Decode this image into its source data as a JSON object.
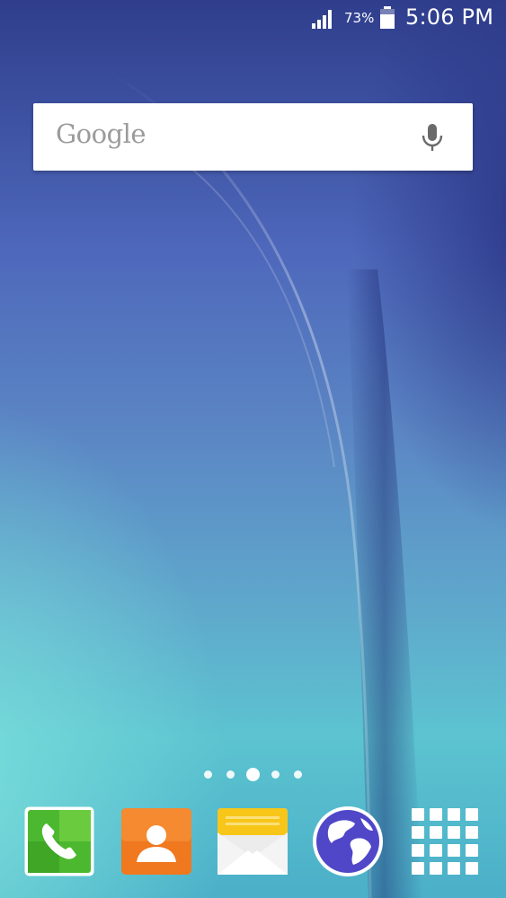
{
  "status_bar": {
    "battery_percent": "73%",
    "time": "5:06 PM",
    "icons": [
      "signal-icon",
      "battery-icon"
    ]
  },
  "search_widget": {
    "logo_text": "Google",
    "icons": [
      "mic-icon"
    ]
  },
  "page_indicator": {
    "page_count": 5,
    "current_page": 3
  },
  "dock": {
    "apps": [
      "phone-icon",
      "contacts-icon",
      "messages-icon",
      "internet-icon",
      "apps-grid-icon"
    ]
  },
  "colors": {
    "phone_green": "#4cb82f",
    "contacts_orange": "#f0781e",
    "messages_yellow": "#f7c619",
    "internet_blue": "#5046c8"
  }
}
